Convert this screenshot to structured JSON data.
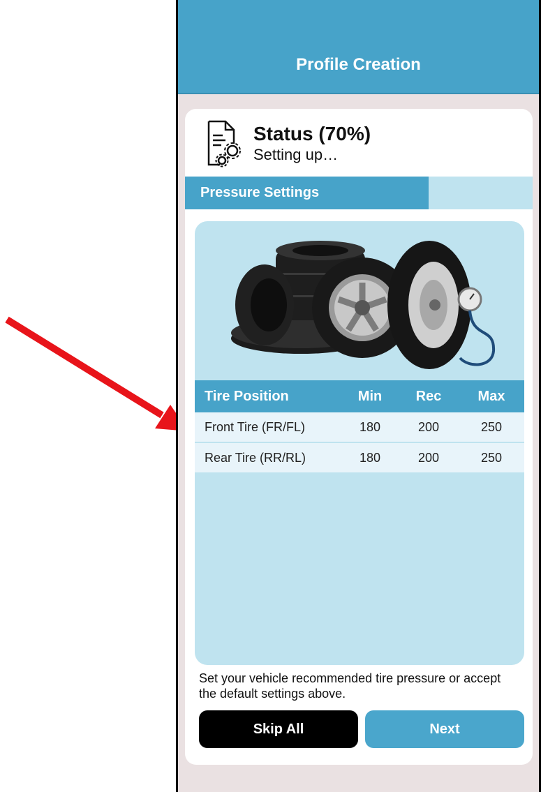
{
  "header": {
    "title": "Profile Creation"
  },
  "status": {
    "title": "Status (70%)",
    "subtitle": "Setting up…",
    "progress": 0.7
  },
  "section": {
    "label": "Pressure Settings"
  },
  "table": {
    "headers": [
      "Tire Position",
      "Min",
      "Rec",
      "Max"
    ],
    "rows": [
      [
        "Front Tire (FR/FL)",
        "180",
        "200",
        "250"
      ],
      [
        "Rear Tire (RR/RL)",
        "180",
        "200",
        "250"
      ]
    ]
  },
  "footer": {
    "text": "Set your vehicle recommended tire pressure or accept the default settings above."
  },
  "buttons": {
    "skip": "Skip All",
    "next": "Next"
  },
  "colors": {
    "accent": "#47a3c9",
    "panel": "#bfe3ef",
    "arrow": "#e8141a"
  },
  "icons": {
    "status": "settings-document-icon",
    "annotation": "red-arrow-icon"
  }
}
